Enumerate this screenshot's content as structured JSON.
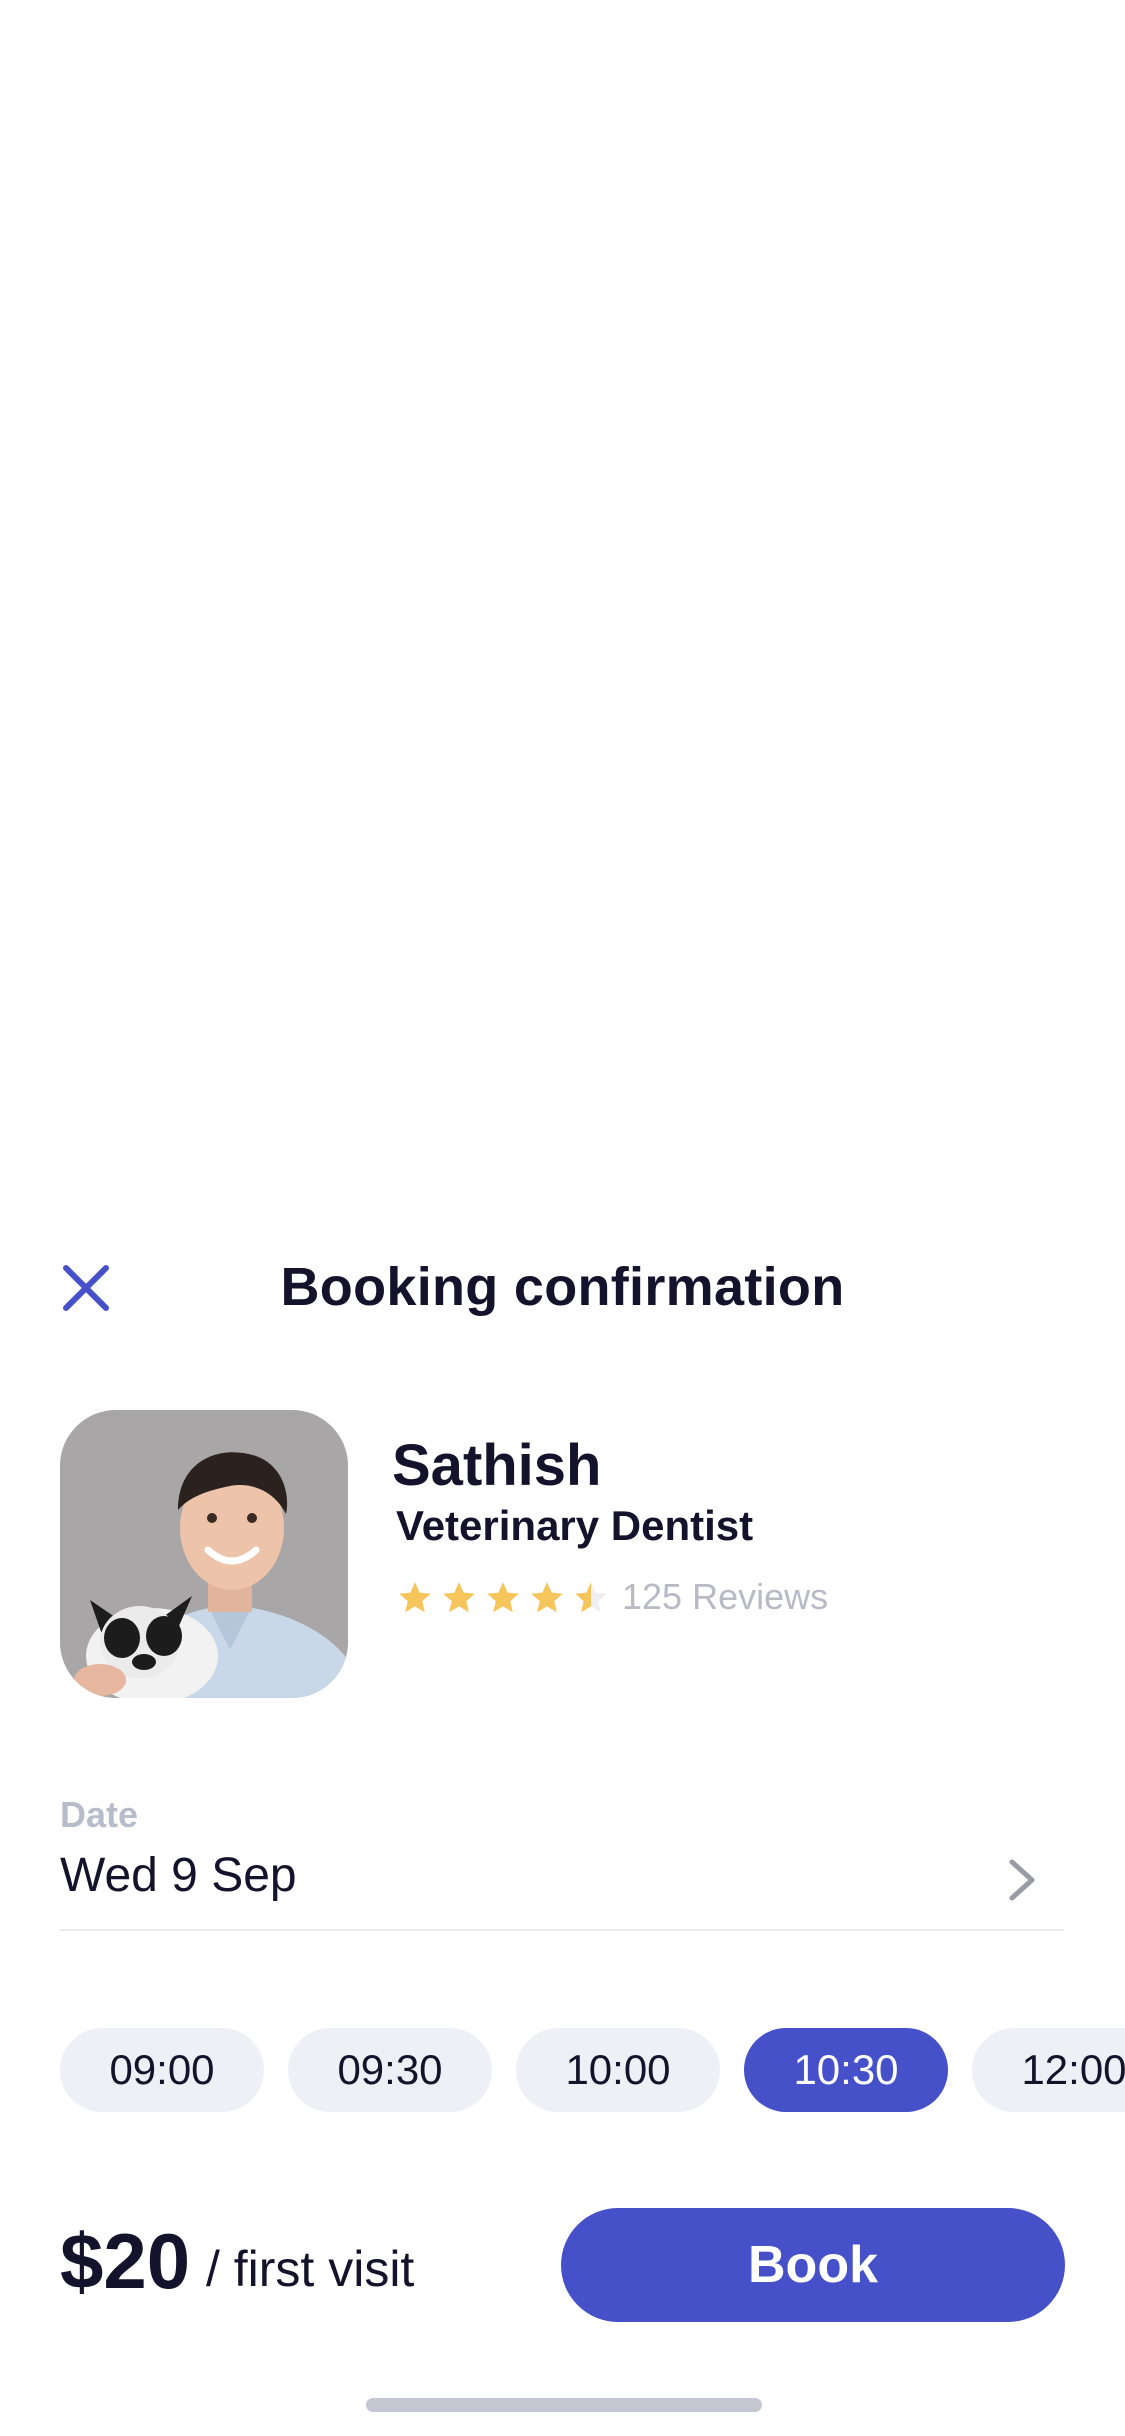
{
  "modal": {
    "title": "Booking confirmation",
    "close_icon": "close-icon",
    "accent_color": "#4550c9"
  },
  "doctor": {
    "name": "Sathish",
    "specialty": "Veterinary Dentist",
    "rating": 4.5,
    "rating_max": 5,
    "reviews": "125 Reviews",
    "star_color": "#f6c55c"
  },
  "date": {
    "label": "Date",
    "value": "Wed 9 Sep",
    "chevron_icon": "chevron-right-icon"
  },
  "slots": [
    {
      "time": "09:00",
      "selected": false
    },
    {
      "time": "09:30",
      "selected": false
    },
    {
      "time": "10:00",
      "selected": false
    },
    {
      "time": "10:30",
      "selected": true
    },
    {
      "time": "12:00",
      "selected": false
    }
  ],
  "footer": {
    "price": "$20",
    "price_suffix": "/ first visit",
    "book_label": "Book"
  }
}
